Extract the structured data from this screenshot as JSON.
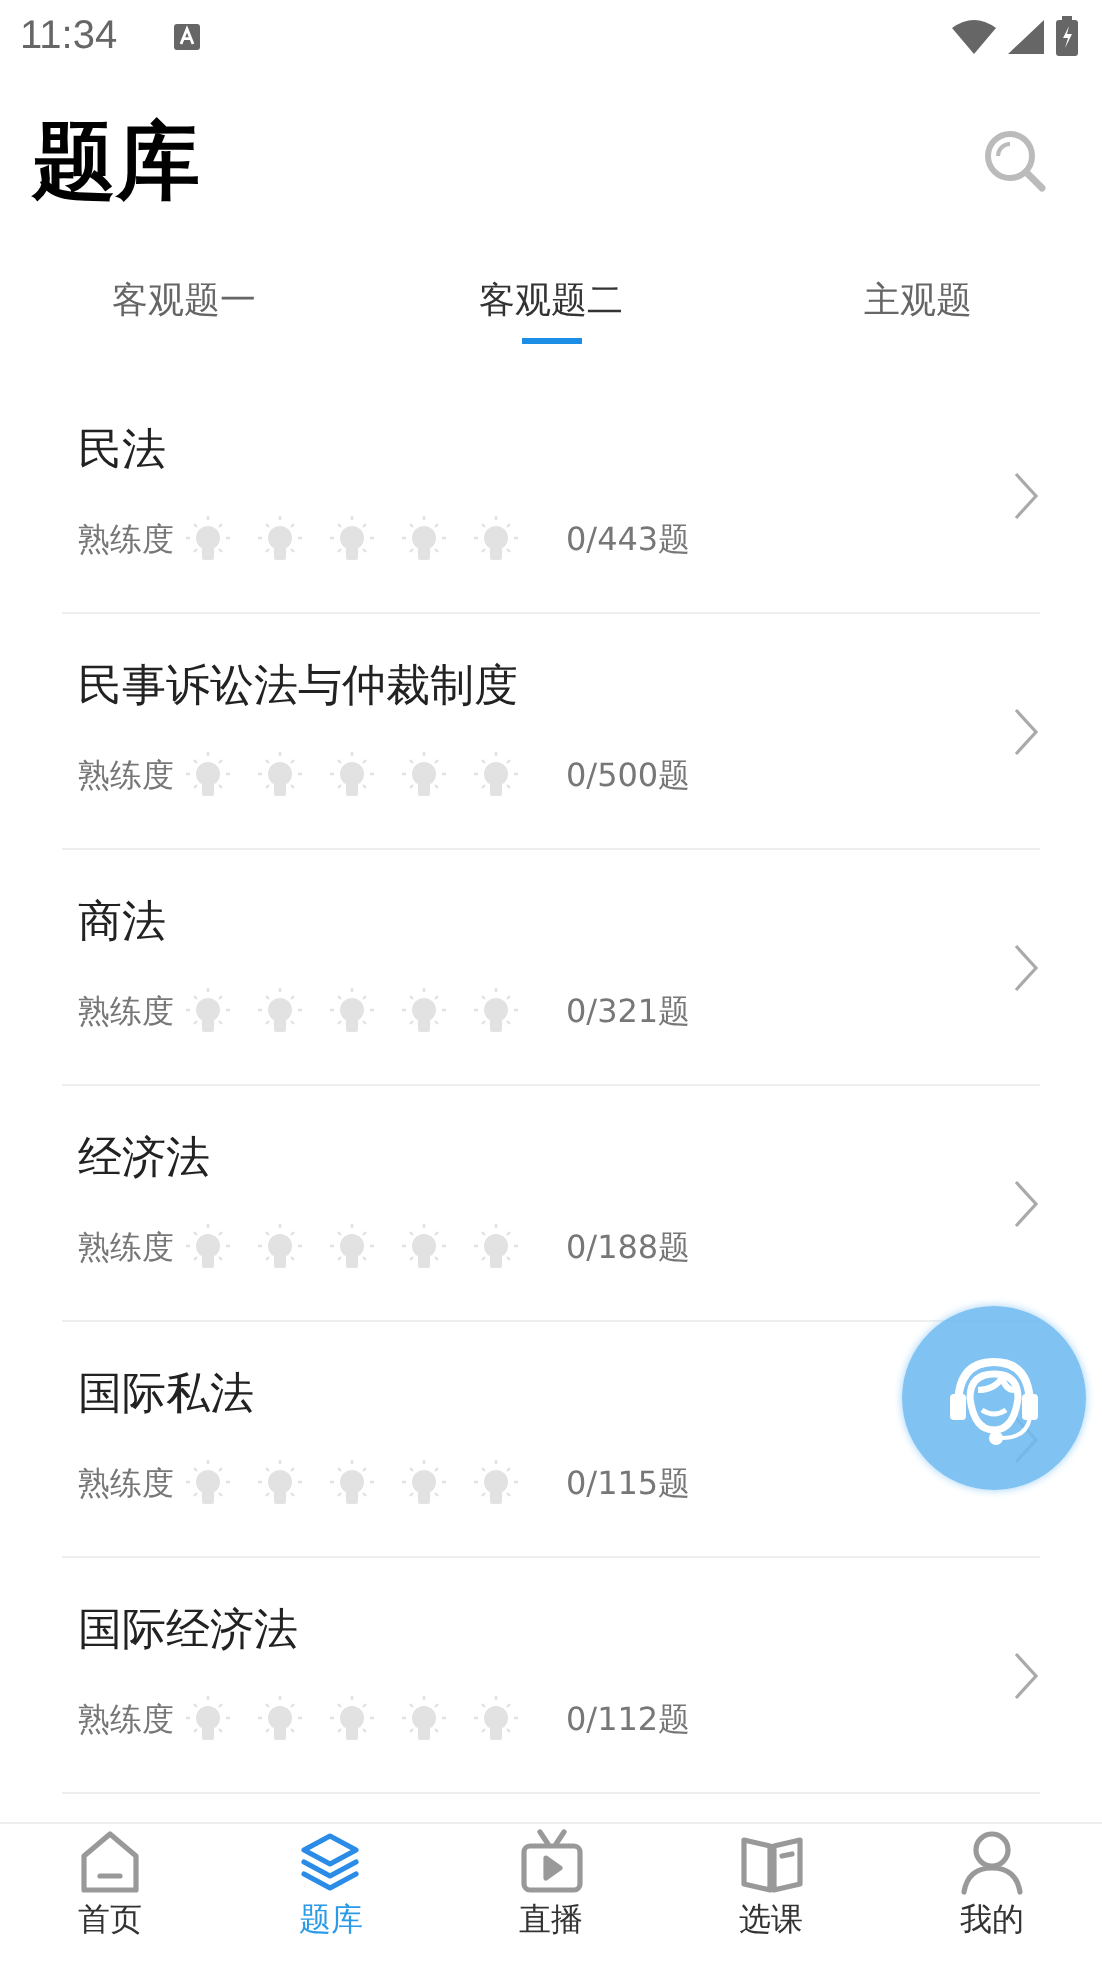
{
  "status_bar": {
    "time": "11:34"
  },
  "header": {
    "title": "题库"
  },
  "tabs": [
    {
      "label": "客观题一",
      "selected": false
    },
    {
      "label": "客观题二",
      "selected": true
    },
    {
      "label": "主观题",
      "selected": false
    }
  ],
  "subjects": [
    {
      "name": "民法",
      "proficiency_label": "熟练度",
      "stars": 0,
      "progress": "0/443题"
    },
    {
      "name": "民事诉讼法与仲裁制度",
      "proficiency_label": "熟练度",
      "stars": 0,
      "progress": "0/500题"
    },
    {
      "name": "商法",
      "proficiency_label": "熟练度",
      "stars": 0,
      "progress": "0/321题"
    },
    {
      "name": "经济法",
      "proficiency_label": "熟练度",
      "stars": 0,
      "progress": "0/188题"
    },
    {
      "name": "国际私法",
      "proficiency_label": "熟练度",
      "stars": 0,
      "progress": "0/115题"
    },
    {
      "name": "国际经济法",
      "proficiency_label": "熟练度",
      "stars": 0,
      "progress": "0/112题"
    }
  ],
  "bottom_nav": [
    {
      "label": "首页",
      "kind": "home",
      "selected": false
    },
    {
      "label": "题库",
      "kind": "layers",
      "selected": true
    },
    {
      "label": "直播",
      "kind": "tv",
      "selected": false
    },
    {
      "label": "选课",
      "kind": "book",
      "selected": false
    },
    {
      "label": "我的",
      "kind": "person",
      "selected": false
    }
  ]
}
